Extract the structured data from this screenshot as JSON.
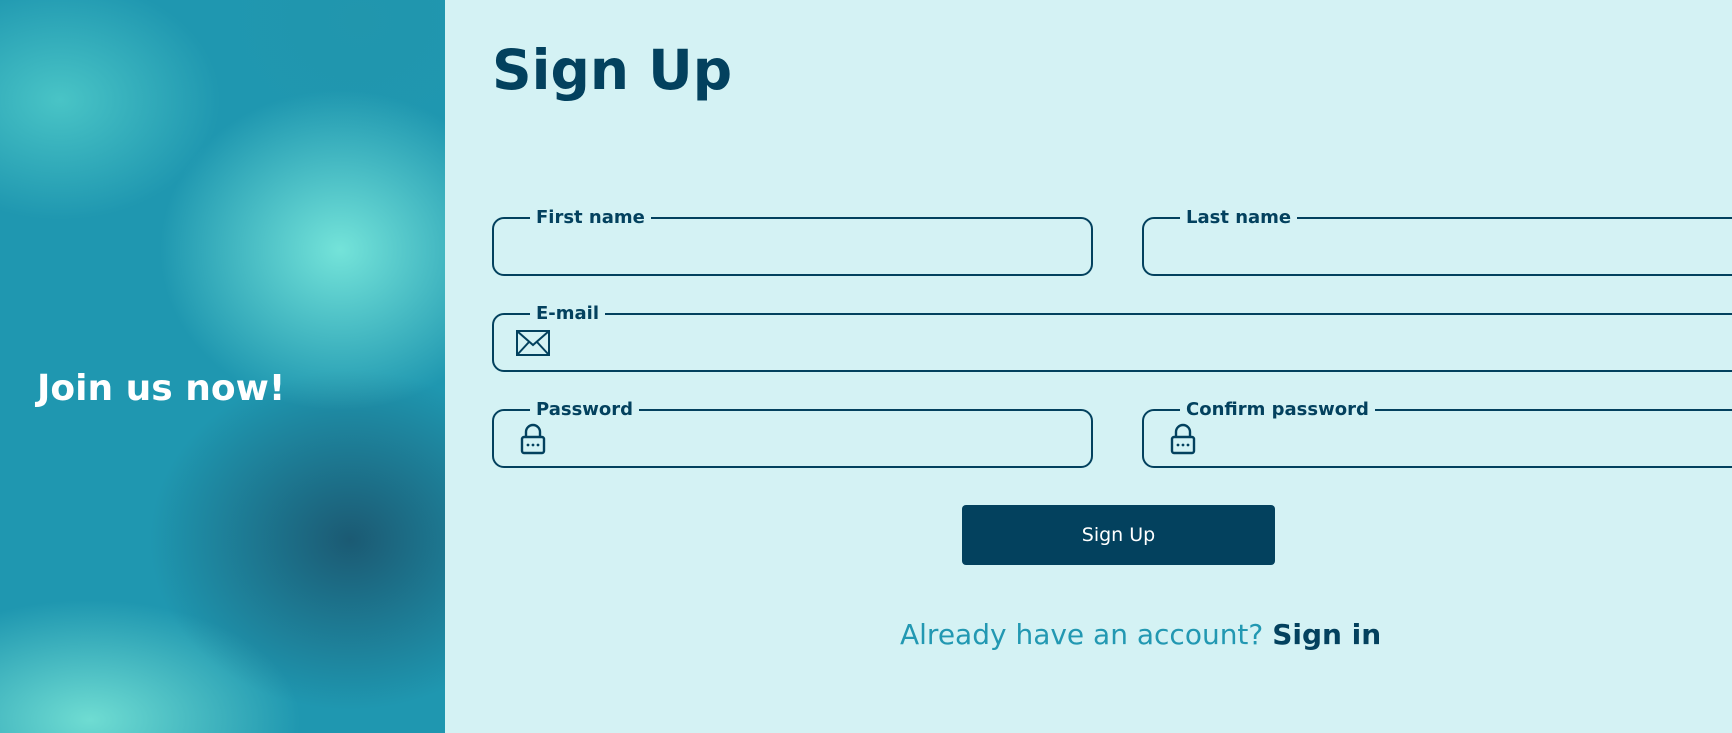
{
  "left_panel": {
    "headline": "Join us now!"
  },
  "form": {
    "title": "Sign Up",
    "fields": {
      "first_name": {
        "label": "First name",
        "value": ""
      },
      "last_name": {
        "label": "Last name",
        "value": ""
      },
      "email": {
        "label": "E-mail",
        "value": "",
        "icon": "envelope-icon"
      },
      "password": {
        "label": "Password",
        "value": "",
        "icon": "lock-icon"
      },
      "confirm_password": {
        "label": "Confirm password",
        "value": "",
        "icon": "lock-icon"
      }
    },
    "submit_label": "Sign Up",
    "signin_prompt": "Already have an account?",
    "signin_link": "Sign in"
  },
  "colors": {
    "primary": "#03415e",
    "background": "#d4f2f4",
    "accent_text": "#2298b2",
    "panel_teal": "#1f97b0"
  }
}
